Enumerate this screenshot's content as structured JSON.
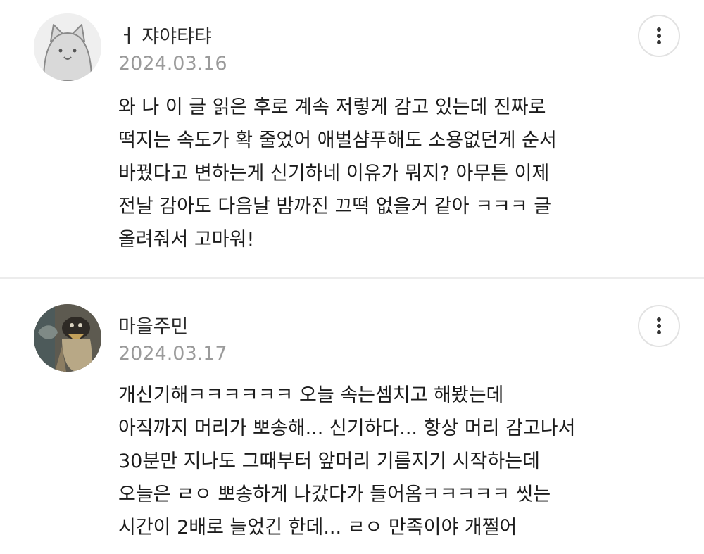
{
  "comments": [
    {
      "username": "ㅓ 쟈야탸탸",
      "date": "2024.03.16",
      "avatar_icon": "gray-cat-face-avatar",
      "more_icon": "vertical-ellipsis-icon",
      "lines": [
        "와 나 이 글 읽은 후로 계속 저렇게 감고 있는데 진짜로",
        "떡지는 속도가 확 줄었어 애벌샴푸해도 소용없던게 순서",
        "바꿨다고 변하는게 신기하네 이유가 뭐지? 아무튼 이제",
        "전날 감아도 다음날 밤까진 끄떡 없을거 같아 ㅋㅋㅋ 글",
        "올려줘서 고마워!"
      ]
    },
    {
      "username": "마을주민",
      "date": "2024.03.17",
      "avatar_icon": "penguin-photo-avatar",
      "more_icon": "vertical-ellipsis-icon",
      "lines": [
        "개신기해ㅋㅋㅋㅋㅋㅋ 오늘 속는셈치고 해봤는데",
        "아직까지 머리가 뽀송해... 신기하다... 항상 머리 감고나서",
        "30분만 지나도 그때부터 앞머리 기름지기 시작하는데",
        "오늘은 ㄹㅇ 뽀송하게 나갔다가 들어옴ㅋㅋㅋㅋㅋ 씻는",
        "시간이 2배로 늘었긴 한데... ㄹㅇ 만족이야 개쩔어"
      ]
    }
  ],
  "colors": {
    "background": "#ffffff",
    "text": "#1c1c1c",
    "date": "#9a9a9a",
    "divider": "#ececec",
    "button_border": "#e2e2e2"
  }
}
